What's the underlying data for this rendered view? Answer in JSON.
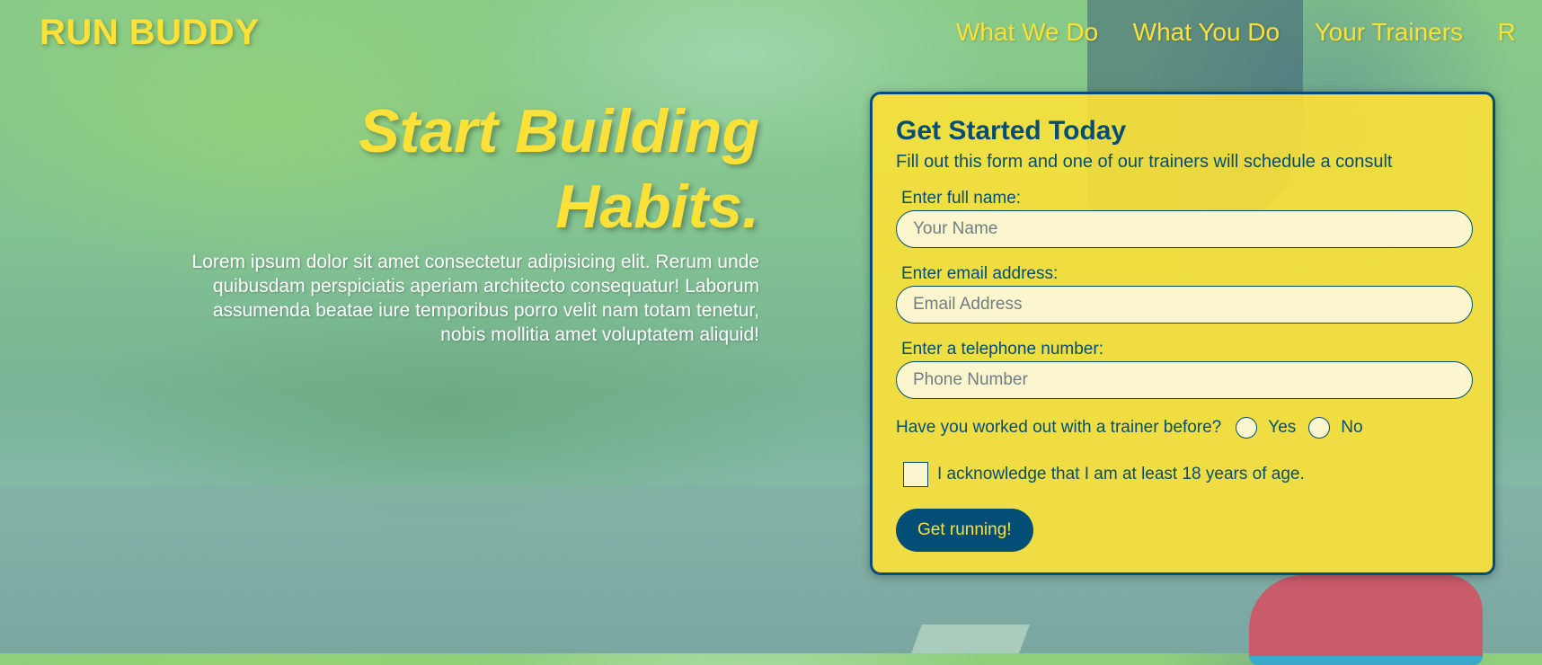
{
  "header": {
    "logo": "RUN BUDDY",
    "nav": [
      "What We Do",
      "What You Do",
      "Your Trainers",
      "R"
    ]
  },
  "hero": {
    "title_line1": "Start Building",
    "title_line2": "Habits.",
    "body": "Lorem ipsum dolor sit amet consectetur adipisicing elit. Rerum unde quibusdam perspiciatis aperiam architecto consequatur! Laborum assumenda beatae iure temporibus porro velit nam totam tenetur, nobis mollitia amet voluptatem aliquid!"
  },
  "form": {
    "title": "Get Started Today",
    "subtitle": "Fill out this form and one of our trainers will schedule a consult",
    "name_label": "Enter full name:",
    "name_placeholder": "Your Name",
    "email_label": "Enter email address:",
    "email_placeholder": "Email Address",
    "phone_label": "Enter a telephone number:",
    "phone_placeholder": "Phone Number",
    "trainer_question": "Have you worked out with a trainer before?",
    "yes_label": "Yes",
    "no_label": "No",
    "age_ack": "I acknowledge that I am at least 18 years of age.",
    "submit": "Get running!"
  },
  "colors": {
    "brand_yellow": "#fce138",
    "brand_navy": "#024e76"
  }
}
